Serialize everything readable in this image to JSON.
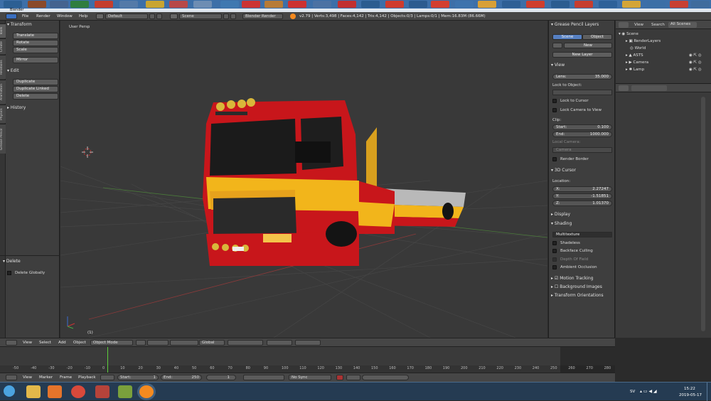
{
  "window": {
    "title": "Blender"
  },
  "info_header": {
    "menus": [
      "File",
      "Render",
      "Window",
      "Help"
    ],
    "layout": "Default",
    "scene": "Scene",
    "engine": "Blender Render",
    "stats": "v2.79 | Verts:3,498 | Faces:4,142 | Tris:4,142 | Objects:0/3 | Lamps:0/1 | Mem:16.83M (86.66M)"
  },
  "tool_tabs": [
    "Tools",
    "Create",
    "Relations",
    "Animation",
    "Physics",
    "Grease Pencil"
  ],
  "tools": {
    "transform": {
      "header": "Transform",
      "buttons": [
        "Translate",
        "Rotate",
        "Scale",
        "Mirror"
      ]
    },
    "edit": {
      "header": "Edit",
      "buttons": [
        "Duplicate",
        "Duplicate Linked",
        "Delete"
      ]
    },
    "history": {
      "header": "History"
    },
    "operator": {
      "header": "Delete",
      "option": "Delete Globally"
    }
  },
  "viewport": {
    "label": "User Persp",
    "object_label": "(1)"
  },
  "properties": {
    "grease_pencil": {
      "header": "Grease Pencil Layers",
      "tabs": [
        "Scene",
        "Object"
      ],
      "new_label": "New",
      "new_layer": "New Layer"
    },
    "view": {
      "header": "View",
      "lens_label": "Lens:",
      "lens_value": "35.000",
      "lock_object_label": "Lock to Object:",
      "lock_cursor": "Lock to Cursor",
      "lock_camera": "Lock Camera to View",
      "clip_label": "Clip:",
      "clip_start_label": "Start:",
      "clip_start": "0.100",
      "clip_end_label": "End:",
      "clip_end": "1000.000",
      "local_camera_label": "Local Camera:",
      "local_camera_value": "Camera",
      "render_border": "Render Border"
    },
    "cursor": {
      "header": "3D Cursor",
      "location_label": "Location:",
      "x_label": "X:",
      "x": "2.27247",
      "y_label": "Y:",
      "y": "-1.51851",
      "z_label": "Z:",
      "z": "1.01370"
    },
    "display": {
      "header": "Display"
    },
    "shading": {
      "header": "Shading",
      "mode": "Multitexture",
      "options": [
        "Shadeless",
        "Backface Culling",
        "Depth Of Field",
        "Ambient Occlusion"
      ]
    },
    "motion_tracking": "Motion Tracking",
    "background_images": "Background Images",
    "transform_orientations": "Transform Orientations"
  },
  "outliner": {
    "header": {
      "view": "View",
      "search": "Search",
      "filter": "All Scenes"
    },
    "items": [
      "Scene",
      "RenderLayers",
      "World",
      "ASTS",
      "Camera",
      "Lamp"
    ]
  },
  "view3d_header": {
    "menus": [
      "View",
      "Select",
      "Add",
      "Object"
    ],
    "mode": "Object Mode",
    "orientation": "Global"
  },
  "timeline": {
    "ruler": [
      "-50",
      "-40",
      "-30",
      "-20",
      "-10",
      "0",
      "10",
      "20",
      "30",
      "40",
      "50",
      "60",
      "70",
      "80",
      "90",
      "100",
      "110",
      "120",
      "130",
      "140",
      "150",
      "160",
      "170",
      "180",
      "190",
      "200",
      "210",
      "220",
      "230",
      "240",
      "250",
      "260",
      "270",
      "280"
    ],
    "menus": [
      "View",
      "Marker",
      "Frame",
      "Playback"
    ],
    "start_label": "Start:",
    "start": "1",
    "end_label": "End:",
    "end": "250",
    "current": "1",
    "sync": "No Sync"
  },
  "taskbar": {
    "language": "SV",
    "time": "15:22",
    "date": "2019-05-17"
  },
  "colors": {
    "truck_red": "#c8161b",
    "truck_yellow": "#f2b51b",
    "selection_orange": "#f58a1f",
    "blender_blue": "#5680c2"
  }
}
